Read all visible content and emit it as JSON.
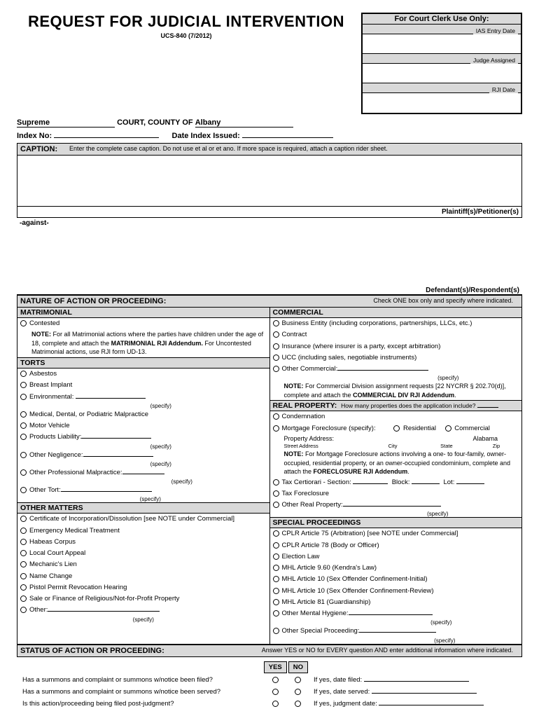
{
  "title": "REQUEST FOR JUDICIAL INTERVENTION",
  "form_code": "UCS-840   (7/2012)",
  "clerk": {
    "header": "For Court Clerk Use Only:",
    "ias": "IAS Entry Date",
    "judge": "Judge Assigned",
    "rji": "RJI Date"
  },
  "court_type": "Supreme",
  "court_label": "COURT,  COUNTY OF",
  "county": "Albany",
  "index_label": "Index No:",
  "date_index_label": "Date Index Issued:",
  "caption": {
    "label": "CAPTION:",
    "instr": "Enter the complete case caption.  Do not use et al or et ano.  If more space is required, attach a caption rider sheet.",
    "plaintiff": "Plaintiff(s)/Petitioner(s)",
    "against": "-against-",
    "defendant": "Defendant(s)/Respondent(s)"
  },
  "nature": {
    "header": "NATURE OF ACTION OR PROCEEDING:",
    "sub": "Check ONE box only and specify where indicated.",
    "matrimonial": {
      "hdr": "MATRIMONIAL",
      "contested": "Contested",
      "note": "NOTE:  For all Matrimonial actions where the parties have children under the age of 18, complete and attach the MATRIMONIAL RJI Addendum. For Uncontested Matrimonial actions, use RJI form UD-13."
    },
    "torts": {
      "hdr": "TORTS",
      "asbestos": "Asbestos",
      "breast": "Breast Implant",
      "env": "Environmental:",
      "medical": "Medical, Dental, or Podiatric Malpractice",
      "motor": "Motor Vehicle",
      "products": "Products Liability:",
      "other_neg": "Other Negligence:",
      "other_prof": "Other Professional Malpractice:",
      "other_tort": "Other Tort:"
    },
    "other_matters": {
      "hdr": "OTHER MATTERS",
      "cert": "Certificate of Incorporation/Dissolution    [see NOTE under Commercial]",
      "emerg": "Emergency Medical Treatment",
      "habeas": "Habeas Corpus",
      "local": "Local Court Appeal",
      "mech": "Mechanic's Lien",
      "name": "Name Change",
      "pistol": "Pistol Permit Revocation Hearing",
      "sale": "Sale or Finance of Religious/Not-for-Profit Property",
      "other": "Other:"
    },
    "commercial": {
      "hdr": "COMMERCIAL",
      "biz": "Business Entity (including corporations, partnerships, LLCs, etc.)",
      "contract": "Contract",
      "ins": "Insurance (where insurer is a party, except arbitration)",
      "ucc": "UCC (including sales, negotiable instruments)",
      "other": "Other Commercial:",
      "note": "NOTE:  For Commercial Division assignment requests [22 NYCRR § 202.70(d)], complete and attach the COMMERCIAL DIV RJI Addendum."
    },
    "real_prop": {
      "hdr": "REAL PROPERTY:",
      "hdr_sub": "How many properties does the application include?",
      "cond": "Condemnation",
      "mort": "Mortgage Foreclosure (specify):",
      "res": "Residential",
      "com": "Commercial",
      "addr_lbl": "Property Address:",
      "state_default": "Alabama",
      "addr_street": "Street Address",
      "addr_city": "City",
      "addr_state": "State",
      "addr_zip": "Zip",
      "note": "NOTE: For Mortgage Foreclosure actions involving a one- to four-family, owner-occupied, residential property, or an owner-occupied condominium, complete and attach the FORECLOSURE RJI Addendum.",
      "tax_cert": "Tax Certiorari - Section:",
      "block": "Block:",
      "lot": "Lot:",
      "tax_fore": "Tax Foreclosure",
      "other_real": "Other Real Property:"
    },
    "special": {
      "hdr": "SPECIAL PROCEEDINGS",
      "c75": "CPLR Article 75 (Arbitration)    [see NOTE under Commercial]",
      "c78": "CPLR Article 78 (Body or Officer)",
      "election": "Election Law",
      "mhl960": "MHL Article 9.60 (Kendra's Law)",
      "mhl10i": "MHL Article 10 (Sex Offender Confinement-Initial)",
      "mhl10r": "MHL Article 10 (Sex Offender Confinement-Review)",
      "mhl81": "MHL Article 81 (Guardianship)",
      "other_mh": "Other Mental Hygiene:",
      "other_sp": "Other Special Proceeding:"
    }
  },
  "status": {
    "header": "STATUS OF ACTION OR PROCEEDING:",
    "sub": "Answer YES or NO for EVERY question AND enter additional information where indicated.",
    "yes": "YES",
    "no": "NO",
    "q1": "Has a summons and complaint or summons w/notice been filed?",
    "q1f": "If yes, date filed:",
    "q2": "Has a summons and complaint or summons w/notice been served?",
    "q2f": "If yes, date served:",
    "q3": "Is this action/proceeding being filed post-judgment?",
    "q3f": "If yes, judgment date:"
  },
  "specify_lbl": "(specify)"
}
